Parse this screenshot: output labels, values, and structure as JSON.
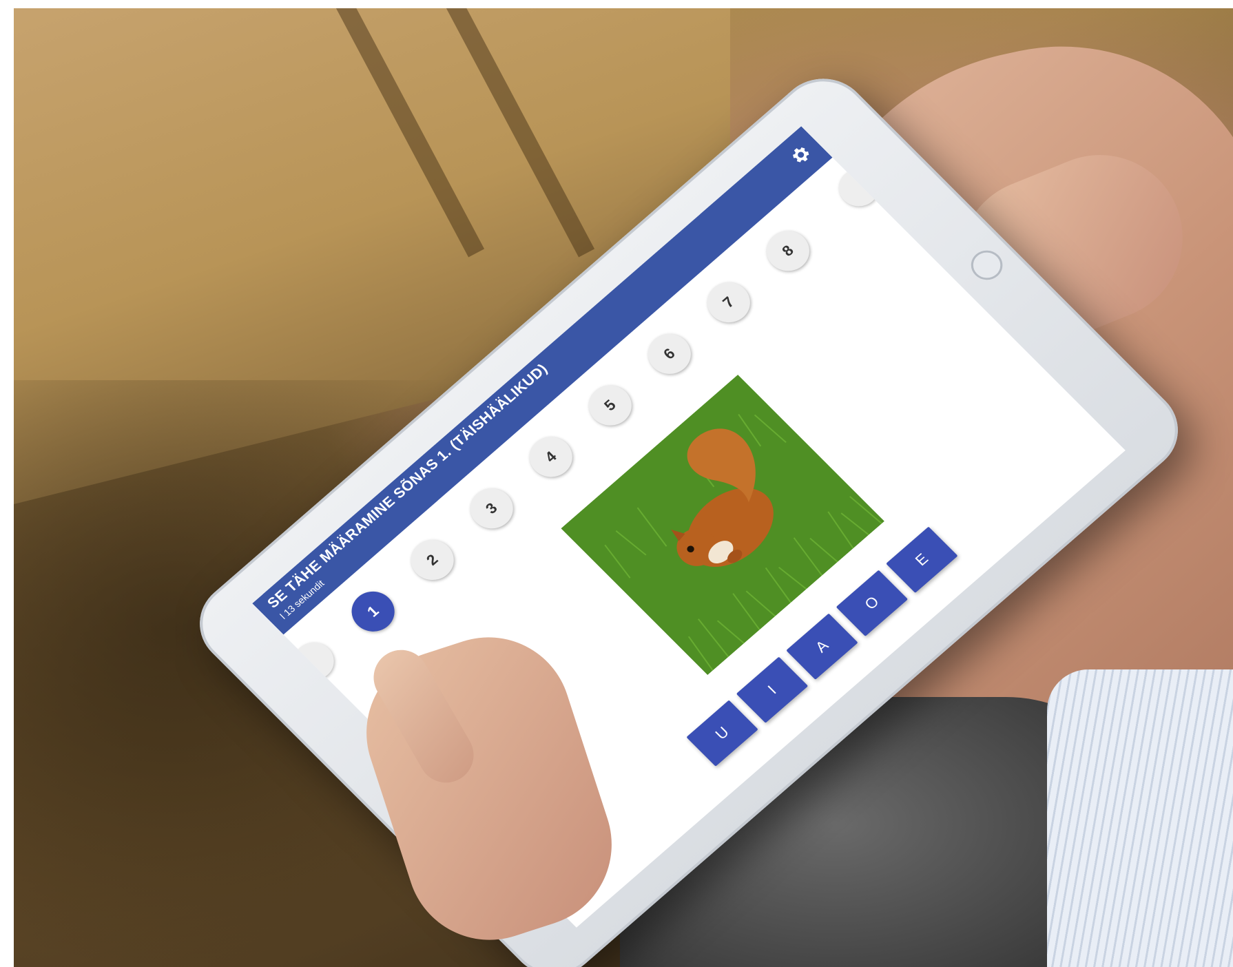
{
  "app": {
    "title": "SE TÄHE MÄÄRAMINE SÕNAS 1. (TÄISHÄÄLIKUD)",
    "subtitle": "l 13 sekundit"
  },
  "icons": {
    "settings": "gear-icon",
    "previous": "previous-page-button",
    "next": "next-page-button"
  },
  "steps": [
    "1",
    "2",
    "3",
    "4",
    "5",
    "6",
    "7",
    "8"
  ],
  "active_step": "1",
  "picture": {
    "subject": "squirrel-image"
  },
  "answers": [
    "U",
    "I",
    "A",
    "O",
    "E"
  ],
  "colors": {
    "appbar": "#3a56a6",
    "accent": "#3a4fb5",
    "step_inactive": "#eeeeee"
  }
}
